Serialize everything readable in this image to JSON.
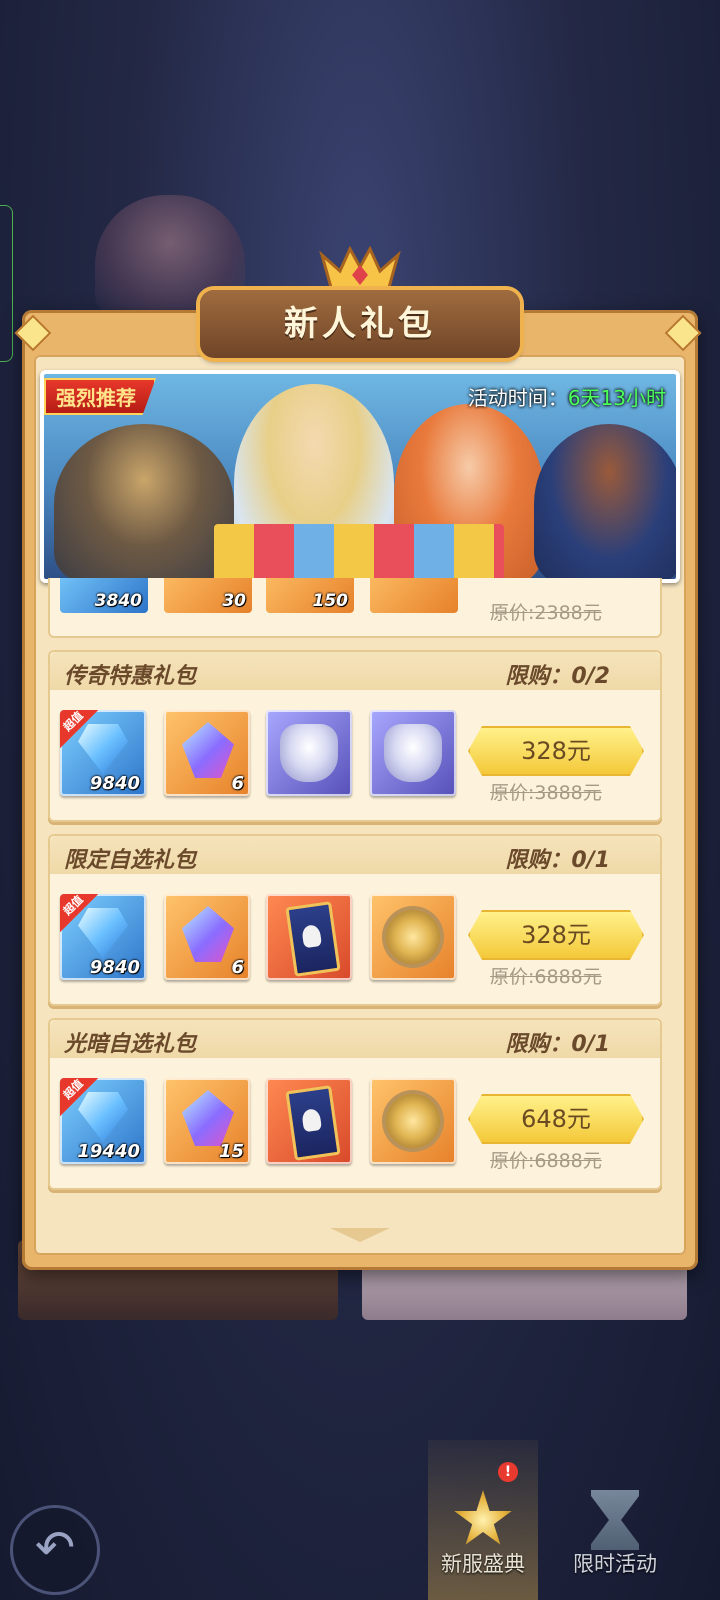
{
  "title": "新人礼包",
  "banner": {
    "tag": "强烈推荐",
    "time_label": "活动时间：",
    "time_value": "6天13小时"
  },
  "partial_pack": {
    "counts": [
      "3840",
      "30",
      "150",
      ""
    ],
    "original_price": "原价:2388元"
  },
  "packs": [
    {
      "name": "传奇特惠礼包",
      "limit": "限购：0/2",
      "items": [
        {
          "icon": "diamond-icon",
          "count": "9840",
          "tag": "超值"
        },
        {
          "icon": "crystal-icon",
          "count": "6"
        },
        {
          "icon": "armor-icon",
          "count": ""
        },
        {
          "icon": "armor-icon",
          "count": ""
        }
      ],
      "price": "328元",
      "original_price": "原价:3888元"
    },
    {
      "name": "限定自选礼包",
      "limit": "限购：0/1",
      "items": [
        {
          "icon": "diamond-icon",
          "count": "9840",
          "tag": "超值"
        },
        {
          "icon": "crystal-icon",
          "count": "6"
        },
        {
          "icon": "hero-card-icon",
          "count": ""
        },
        {
          "icon": "amulet-icon",
          "count": ""
        }
      ],
      "price": "328元",
      "original_price": "原价:6888元"
    },
    {
      "name": "光暗自选礼包",
      "limit": "限购：0/1",
      "items": [
        {
          "icon": "diamond-icon",
          "count": "19440",
          "tag": "超值"
        },
        {
          "icon": "crystal-icon",
          "count": "15"
        },
        {
          "icon": "hero-card-icon",
          "count": ""
        },
        {
          "icon": "amulet-icon",
          "count": ""
        }
      ],
      "price": "648元",
      "original_price": "原价:6888元"
    }
  ],
  "nav": {
    "back_icon": "back-arrow-icon",
    "items": [
      {
        "label": "新服盛典",
        "icon": "star-badge-icon",
        "alert": "!"
      },
      {
        "label": "限时活动",
        "icon": "hourglass-icon"
      }
    ]
  },
  "colors": {
    "accent_gold": "#f4c93a",
    "timer_green": "#4cff5a",
    "tag_red": "#e8382b"
  }
}
